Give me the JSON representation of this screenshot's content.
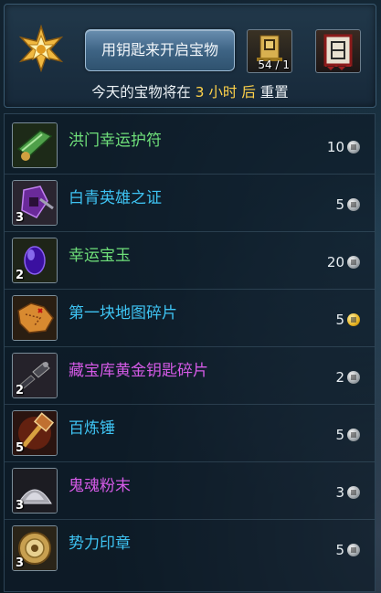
{
  "header": {
    "open_button_label": "用钥匙来开启宝物",
    "key_count": "54 / 1",
    "reset_prefix": "今天的宝物将在",
    "reset_hours": "3 小时 后",
    "reset_suffix": "重置"
  },
  "items": [
    {
      "name": "洪门幸运护符",
      "qty": "",
      "price": "10",
      "currency": "silver",
      "rarity_color": "#6fe07a",
      "icon": "charm-icon"
    },
    {
      "name": "白青英雄之证",
      "qty": "3",
      "price": "5",
      "currency": "silver",
      "rarity_color": "#3ec3f2",
      "icon": "hero-token-icon"
    },
    {
      "name": "幸运宝玉",
      "qty": "2",
      "price": "20",
      "currency": "silver",
      "rarity_color": "#6fe07a",
      "icon": "jade-gem-icon"
    },
    {
      "name": "第一块地图碎片",
      "qty": "",
      "price": "5",
      "currency": "gold",
      "rarity_color": "#3ec3f2",
      "icon": "map-fragment-icon"
    },
    {
      "name": "藏宝库黄金钥匙碎片",
      "qty": "2",
      "price": "2",
      "currency": "silver",
      "rarity_color": "#d45ae6",
      "icon": "key-fragment-icon"
    },
    {
      "name": "百炼锤",
      "qty": "5",
      "price": "5",
      "currency": "silver",
      "rarity_color": "#3ec3f2",
      "icon": "hammer-icon"
    },
    {
      "name": "鬼魂粉末",
      "qty": "3",
      "price": "3",
      "currency": "silver",
      "rarity_color": "#d45ae6",
      "icon": "ghost-powder-icon"
    },
    {
      "name": "势力印章",
      "qty": "3",
      "price": "5",
      "currency": "silver",
      "rarity_color": "#3ec3f2",
      "icon": "faction-seal-icon"
    }
  ]
}
